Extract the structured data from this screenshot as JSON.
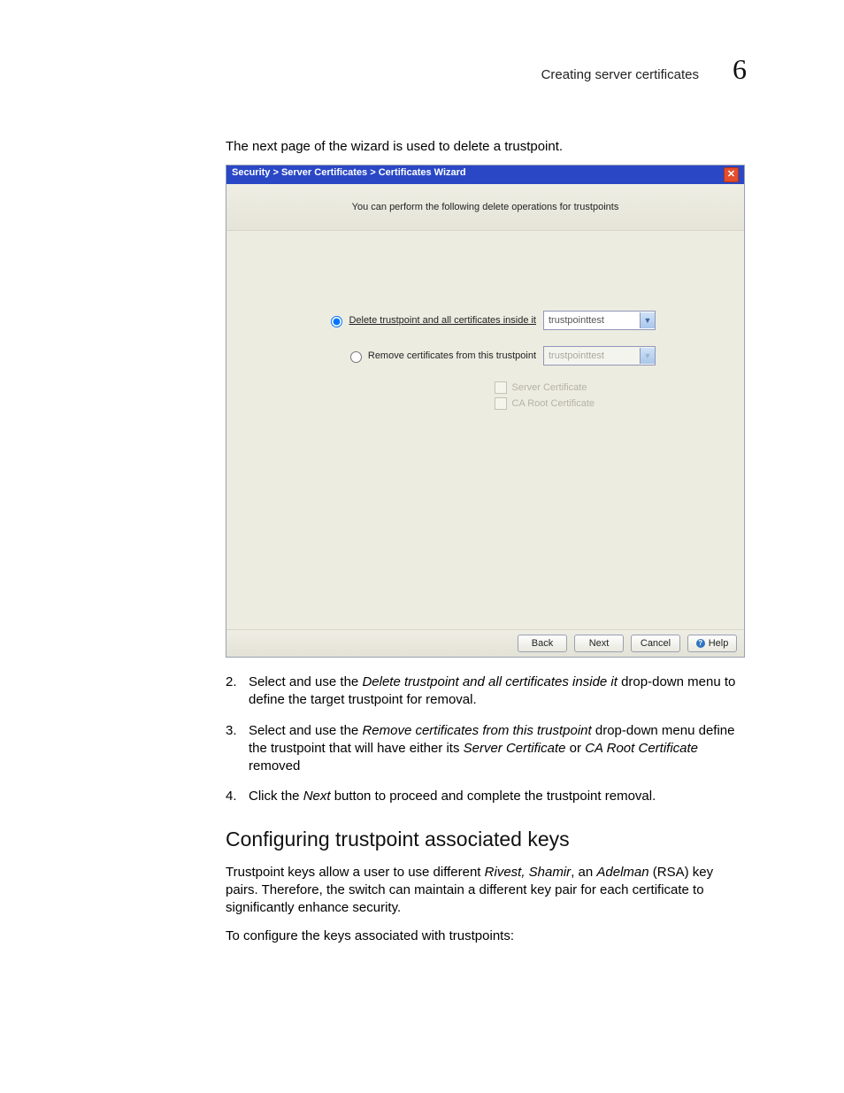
{
  "header": {
    "title": "Creating server certificates",
    "chapter": "6"
  },
  "intro": "The next page of the wizard is used to delete a trustpoint.",
  "wizard": {
    "breadcrumb": "Security > Server Certificates > Certificates Wizard",
    "banner": "You can perform the following delete operations for trustpoints",
    "opt1": {
      "prefix": "Delete trustpoint and all certificates inside it",
      "value": "trustpointtest"
    },
    "opt2": {
      "label": "Remove certificates from this trustpoint",
      "value": "trustpointtest"
    },
    "cb1": "Server Certificate",
    "cb2": "CA Root Certificate",
    "buttons": {
      "back": "Back",
      "next": "Next",
      "cancel": "Cancel",
      "help": "Help"
    }
  },
  "steps": {
    "s2": {
      "num": "2.",
      "pre": "Select and use the ",
      "em": "Delete trustpoint and all certificates inside it",
      "post": " drop-down menu to define the target trustpoint for removal."
    },
    "s3": {
      "num": "3.",
      "pre": "Select and use the ",
      "em1": "Remove certificates from this trustpoint",
      "mid": " drop-down menu define the trustpoint that will have either its ",
      "em2": "Server Certificate",
      "mid2": " or ",
      "em3": "CA Root Certificate",
      "post": " removed"
    },
    "s4": {
      "num": "4.",
      "pre": "Click the ",
      "em": "Next",
      "post": " button to proceed and complete the trustpoint removal."
    }
  },
  "section": {
    "heading": "Configuring trustpoint associated keys",
    "p1": {
      "pre": "Trustpoint keys allow a user to use different ",
      "em1": "Rivest, Shamir",
      "mid": ", an ",
      "em2": "Adelman",
      "post": " (RSA) key pairs. Therefore, the switch can maintain a different key pair for each certificate to significantly enhance security."
    },
    "p2": "To configure the keys associated with trustpoints:"
  }
}
